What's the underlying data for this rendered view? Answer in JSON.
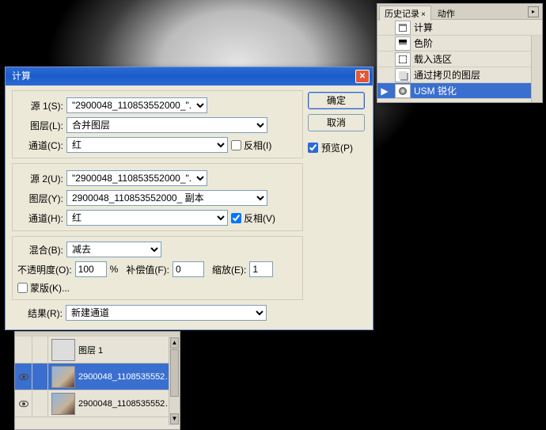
{
  "dialog": {
    "title": "计算",
    "ok_label": "确定",
    "cancel_label": "取消",
    "preview_label": "预览(P)",
    "preview_checked": true,
    "source1": {
      "group_label": "源 1(S):",
      "file_value": "\"2900048_110853552000_\"...",
      "layer_label": "图层(L):",
      "layer_value": "合并图层",
      "channel_label": "通道(C):",
      "channel_value": "红",
      "invert_label": "反相(I)",
      "invert_checked": false
    },
    "source2": {
      "group_label": "源 2(U):",
      "file_value": "\"2900048_110853552000_\"...",
      "layer_label": "图层(Y):",
      "layer_value": "2900048_110853552000_ 副本",
      "channel_label": "通道(H):",
      "channel_value": "红",
      "invert_label": "反相(V)",
      "invert_checked": true
    },
    "blend": {
      "group_label": "混合(B):",
      "mode_value": "减去",
      "opacity_label": "不透明度(O):",
      "opacity_value": "100",
      "percent": "%",
      "offset_label": "补偿值(F):",
      "offset_value": "0",
      "scale_label": "缩放(E):",
      "scale_value": "1",
      "mask_label": "蒙版(K)...",
      "mask_checked": false
    },
    "result": {
      "label": "结果(R):",
      "value": "新建通道"
    }
  },
  "layers_panel": {
    "items": [
      {
        "name": "图层 1",
        "visible": false
      },
      {
        "name": "2900048_11085355520...",
        "visible": true
      },
      {
        "name": "2900048_11085355520...",
        "visible": true
      }
    ],
    "selected_index": 1
  },
  "history_panel": {
    "tabs": {
      "tab1": "历史记录",
      "tab2": "动作"
    },
    "items": [
      {
        "label": "计算"
      },
      {
        "label": "色阶"
      },
      {
        "label": "载入选区"
      },
      {
        "label": "通过拷贝的图层"
      },
      {
        "label": "USM 锐化"
      }
    ],
    "selected_index": 4
  }
}
